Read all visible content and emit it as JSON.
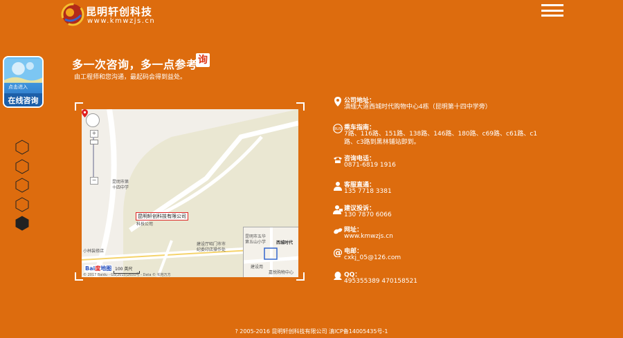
{
  "brand": {
    "title": "昆明轩创科技",
    "url": "www.kmwzjs.cn"
  },
  "consult_badge": {
    "top_text": "点击进入",
    "main_text": "在线咨询"
  },
  "headline": {
    "title": "多一次咨询，多一点参考",
    "icon_char": "询",
    "subtitle": "由工程师和您沟通，最起码会得到益处。"
  },
  "map": {
    "pin_label": "昆明轩创科技有限公司",
    "pin_sublabel": "科技公司",
    "labels": {
      "school": "昆明市第\n十四中学",
      "shop": "小林装修店",
      "office": "建设厅昭门市市\n纪委印店操作处",
      "minimap_title": "西城时代",
      "minimap_school": "昆明市五华\n第五山小学",
      "minimap_bank": "建设用",
      "minimap_mall": "嘉悦购物中心"
    },
    "scale": "100 英尺",
    "copyright": "© 2017 Baidu - GS(2015)2650号 - Data © 长地万方"
  },
  "contact": {
    "items": [
      {
        "label": "公司地址：",
        "value": "滇缅大道西城时代购物中心4栋（昆明第十四中学旁）",
        "icon": "location-icon"
      },
      {
        "label": "乘车指南：",
        "value": "7路、116路、151路、138路、146路、180路、c69路、c61路、c1路、c3路到黑林铺站即到。",
        "icon": "bus-icon"
      },
      {
        "label": "咨询电话：",
        "value": "0871-6819 1916",
        "icon": "phone-icon"
      },
      {
        "label": "客服直通：",
        "value": "135 7718 3381",
        "icon": "customer-service-icon"
      },
      {
        "label": "建议投诉：",
        "value": "130 7870 6066",
        "icon": "complaint-icon"
      },
      {
        "label": "网址：",
        "value": "www.kmwzjs.cn",
        "icon": "website-icon"
      },
      {
        "label": "电邮：",
        "value": "cxkj_05@126.com",
        "icon": "email-icon"
      },
      {
        "label": "QQ：",
        "value": "495355389   470158521",
        "icon": "qq-icon"
      }
    ]
  },
  "footer": {
    "text": "? 2005-2016 昆明轩创科技有限公司   滇ICP备14005435号-1"
  },
  "colors": {
    "background": "#dd6c0e",
    "text": "#ffffff",
    "active_hex": "#222222"
  }
}
